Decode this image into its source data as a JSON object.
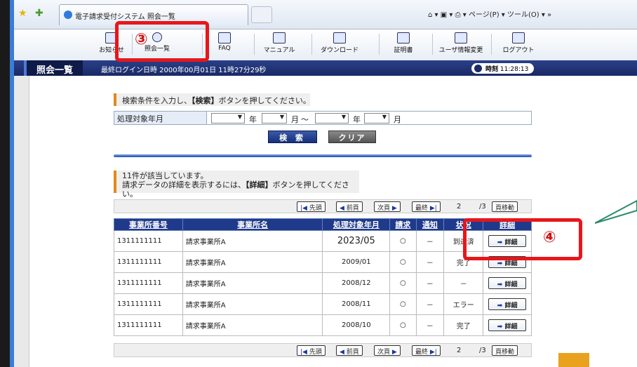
{
  "browser": {
    "tab_title": "電子請求受付システム 照会一覧",
    "right_tools": "ページ(P) ▾  ツール(O) ▾  »"
  },
  "nav": [
    {
      "label": "お知らせ",
      "icon": "notice-icon"
    },
    {
      "label": "照会一覧",
      "icon": "search-icon"
    },
    {
      "label": "FAQ",
      "icon": "faq-icon"
    },
    {
      "label": "マニュアル",
      "icon": "manual-icon"
    },
    {
      "label": "ダウンロード",
      "icon": "download-icon"
    },
    {
      "label": "証明書",
      "icon": "certificate-icon"
    },
    {
      "label": "ユーザ情報変更",
      "icon": "user-info-icon"
    },
    {
      "label": "ログアウト",
      "icon": "logout-icon"
    }
  ],
  "titlebar": {
    "page_title": "照会一覧",
    "last_login": "最終ログイン日時 2000年00月01日 11時27分29秒",
    "clock_label": "時刻",
    "clock_value": "11:28:13"
  },
  "search": {
    "instruction_prefix": "検索条件を入力し、",
    "instruction_bold": "【検索】",
    "instruction_suffix": "ボタンを押してください。",
    "label": "処理対象年月",
    "unit_year": "年",
    "unit_month": "月",
    "range_sep": "～",
    "search_button": "検 索",
    "clear_button": "クリア"
  },
  "result": {
    "count_text": "11件が該当しています。",
    "detail_prefix": "請求データの詳細を表示するには、",
    "detail_bold": "【詳細】",
    "detail_suffix": "ボタンを押してください。"
  },
  "pager": {
    "first": "先頭",
    "prev": "前頁",
    "next": "次頁",
    "last": "最終",
    "current": "2",
    "total": "/3",
    "jump": "頁移動"
  },
  "table": {
    "headers": [
      "事業所番号",
      "事業所名",
      "処理対象年月",
      "請求",
      "通知",
      "状況",
      "詳細"
    ],
    "rows": [
      [
        "1311111111",
        "請求事業所A",
        "2023/05",
        "○",
        "－",
        "到達済",
        "詳細"
      ],
      [
        "1311111111",
        "請求事業所A",
        "2009/01",
        "○",
        "－",
        "完了",
        "詳細"
      ],
      [
        "1311111111",
        "請求事業所A",
        "2008/12",
        "○",
        "－",
        "－",
        "詳細"
      ],
      [
        "1311111111",
        "請求事業所A",
        "2008/11",
        "○",
        "－",
        "エラー",
        "詳細"
      ],
      [
        "1311111111",
        "請求事業所A",
        "2008/10",
        "○",
        "－",
        "完了",
        "詳細"
      ]
    ]
  },
  "annotations": {
    "step3": "③",
    "step4": "④",
    "color": "#e8161a"
  }
}
